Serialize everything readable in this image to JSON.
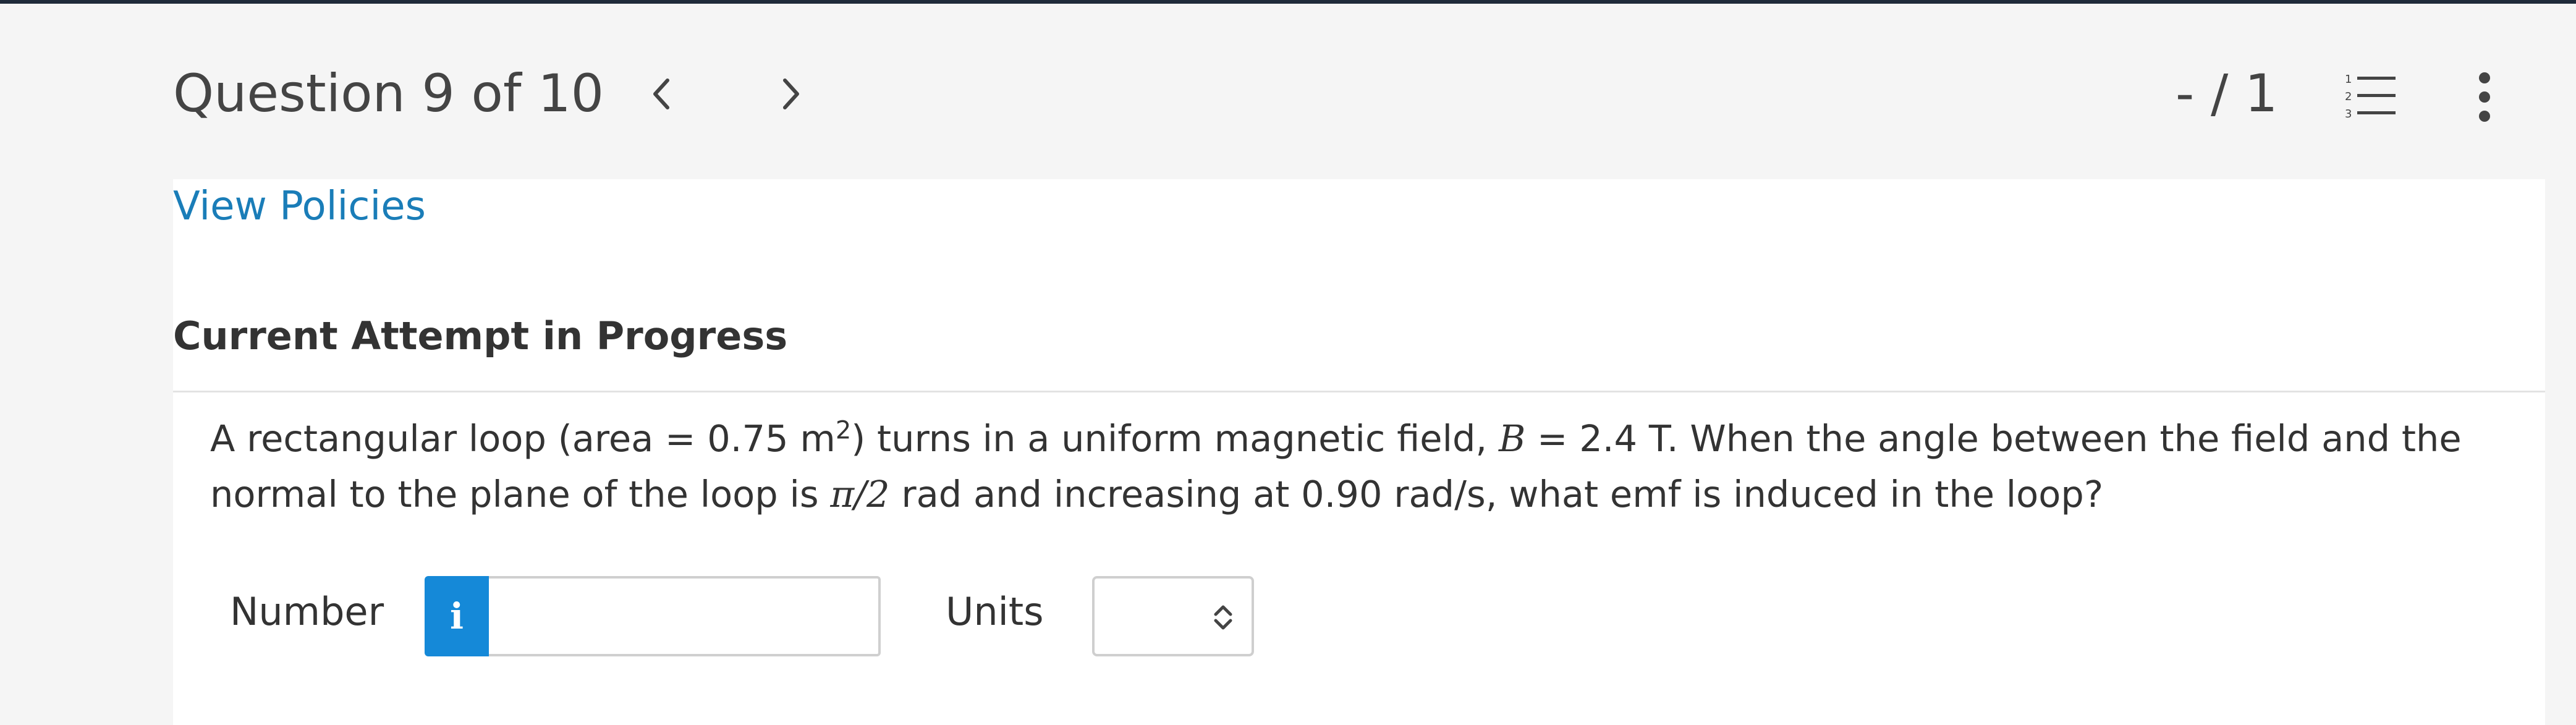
{
  "header": {
    "question_label": "Question 9 of 10",
    "score": "- / 1",
    "list_step_1": "1",
    "list_step_2": "2",
    "list_step_3": "3"
  },
  "links": {
    "view_policies": "View Policies"
  },
  "attempt": {
    "heading": "Current Attempt in Progress"
  },
  "question": {
    "part1": "A rectangular loop (area = 0.75 m",
    "sup": "2",
    "part2": ") turns in a uniform magnetic field, ",
    "var_b": "B",
    "part3": " = 2.4 T. When the angle between the field and the normal to the plane of the loop is ",
    "angle": "π/2",
    "part4": " rad and increasing at 0.90 rad/s, what emf is induced in the loop?"
  },
  "answer": {
    "number_label": "Number",
    "info_glyph": "i",
    "number_value": "",
    "units_label": "Units",
    "units_value": ""
  },
  "colors": {
    "header_bg": "#f5f5f5",
    "top_strip": "#1f2b3a",
    "link": "#1a7db8",
    "info_button": "#1589d8",
    "border": "#cfcfcf"
  }
}
